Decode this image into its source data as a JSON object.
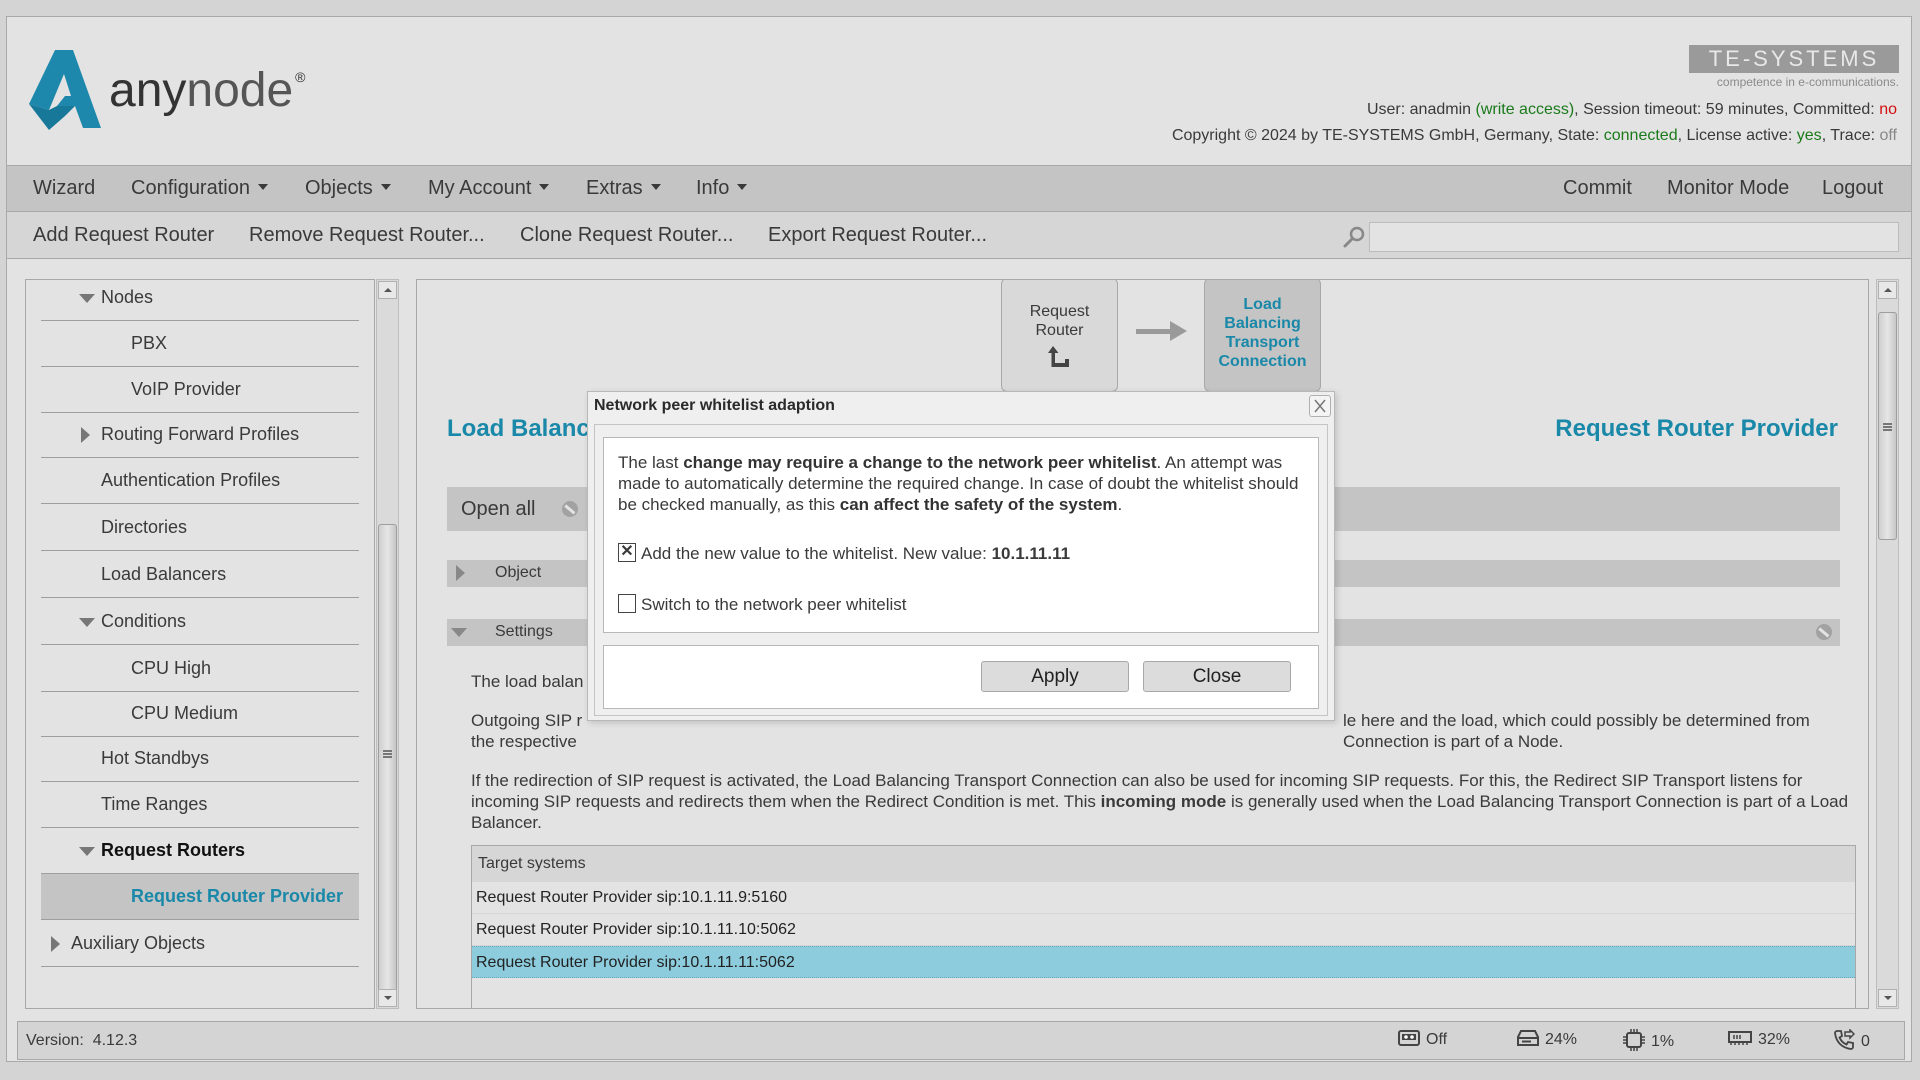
{
  "header": {
    "logo_text_bold": "any",
    "logo_text_light": "node",
    "logo_mark": "®",
    "brand_name": "TE-SYSTEMS",
    "brand_tagline": "competence in e-communications.",
    "user_label": "User:",
    "user_name": "anadmin",
    "user_access": "(write access)",
    "session_label": ", Session timeout: 59 minutes, Committed:",
    "committed_value": "no",
    "copyright": "Copyright © 2024 by TE-SYSTEMS GmbH, Germany, State:",
    "state_value": "connected",
    "license_label": ", License active:",
    "license_value": "yes",
    "trace_label": ", Trace:",
    "trace_value": "off",
    "colors": {
      "accent": "#1a88a8",
      "ok": "#1b7a1b",
      "alert": "#d41010"
    }
  },
  "menubar": {
    "left": [
      {
        "label": "Wizard",
        "dropdown": false
      },
      {
        "label": "Configuration",
        "dropdown": true
      },
      {
        "label": "Objects",
        "dropdown": true
      },
      {
        "label": "My Account",
        "dropdown": true
      },
      {
        "label": "Extras",
        "dropdown": true
      },
      {
        "label": "Info",
        "dropdown": true
      }
    ],
    "right": [
      {
        "label": "Commit"
      },
      {
        "label": "Monitor Mode"
      },
      {
        "label": "Logout"
      }
    ]
  },
  "toolbar": {
    "actions": [
      {
        "label": "Add Request Router"
      },
      {
        "label": "Remove Request Router..."
      },
      {
        "label": "Clone Request Router..."
      },
      {
        "label": "Export Request Router..."
      }
    ],
    "search_value": "",
    "search_icon": "magnifier-icon"
  },
  "sidebar": {
    "items": [
      {
        "label": "Nodes",
        "level": 1,
        "expander": "expanded"
      },
      {
        "label": "PBX",
        "level": 2,
        "expander": "none"
      },
      {
        "label": "VoIP Provider",
        "level": 2,
        "expander": "none"
      },
      {
        "label": "Routing Forward Profiles",
        "level": 1,
        "expander": "collapsed"
      },
      {
        "label": "Authentication Profiles",
        "level": 1,
        "expander": "none"
      },
      {
        "label": "Directories",
        "level": 1,
        "expander": "none"
      },
      {
        "label": "Load Balancers",
        "level": 1,
        "expander": "none"
      },
      {
        "label": "Conditions",
        "level": 1,
        "expander": "expanded"
      },
      {
        "label": "CPU High",
        "level": 2,
        "expander": "none"
      },
      {
        "label": "CPU Medium",
        "level": 2,
        "expander": "none"
      },
      {
        "label": "Hot Standbys",
        "level": 1,
        "expander": "none"
      },
      {
        "label": "Time Ranges",
        "level": 1,
        "expander": "none"
      },
      {
        "label": "Request Routers",
        "level": 1,
        "expander": "expanded",
        "bold": true
      },
      {
        "label": "Request Router Provider",
        "level": 2,
        "expander": "none",
        "selected": true
      },
      {
        "label": "Auxiliary Objects",
        "level": 0,
        "expander": "collapsed"
      }
    ]
  },
  "main": {
    "flow": {
      "step1": {
        "line1": "Request",
        "line2": "Router",
        "icon": "turn-arrow-icon"
      },
      "step2": {
        "lines": [
          "Load",
          "Balancing",
          "Transport",
          "Connection"
        ]
      }
    },
    "title_left": "Load Balancing Transport Connection",
    "title_right": "Request Router Provider",
    "open_all_label": "Open all",
    "sections": [
      {
        "label": "Object",
        "expanded": false
      },
      {
        "label": "Settings",
        "expanded": true
      }
    ],
    "paragraph1_visible": "The load balan",
    "paragraph2_start": "Outgoing SIP r",
    "paragraph2_end_line1": "le here and the load, which could possibly be determined from",
    "paragraph2_line2_start": "the respective",
    "paragraph2_line2_end": "Connection is part of a Node.",
    "paragraph3_a": "If the redirection of SIP request is activated, the Load Balancing Transport Connection can also be used for incoming SIP requests. For this, the Redirect SIP Transport listens for incoming SIP requests and redirects them when the Redirect Condition is met. This ",
    "paragraph3_bold": "incoming mode",
    "paragraph3_b": " is generally used when the Load Balancing Transport Connection is part of a Load Balancer.",
    "table": {
      "header": "Target systems",
      "rows": [
        {
          "value": "Request Router Provider sip:10.1.11.9:5160",
          "selected": false
        },
        {
          "value": "Request Router Provider sip:10.1.11.10:5062",
          "selected": false
        },
        {
          "value": "Request Router Provider sip:10.1.11.11:5062",
          "selected": true
        }
      ]
    }
  },
  "dialog": {
    "title": "Network peer whitelist adaption",
    "text_a": "The last ",
    "text_bold1": "change may require a change to the network peer whitelist",
    "text_b": ". An attempt was made to automatically determine the required change. In case of doubt the whitelist should be checked manually, as this ",
    "text_bold2": "can affect the safety of the system",
    "text_c": ".",
    "option1_label": "Add the new value to the whitelist. New value: ",
    "option1_value": "10.1.11.11",
    "option1_checked": true,
    "option1_mark": "✕",
    "option2_label": "Switch to the network peer whitelist",
    "option2_checked": false,
    "apply_label": "Apply",
    "close_label": "Close"
  },
  "statusbar": {
    "version_label": "Version:",
    "version_value": "4.12.3",
    "items": [
      {
        "icon": "recorder-icon",
        "value": "Off"
      },
      {
        "icon": "disk-icon",
        "value": "24%"
      },
      {
        "icon": "cpu-icon",
        "value": "1%"
      },
      {
        "icon": "memory-icon",
        "value": "32%"
      },
      {
        "icon": "calls-icon",
        "value": "0"
      }
    ]
  }
}
